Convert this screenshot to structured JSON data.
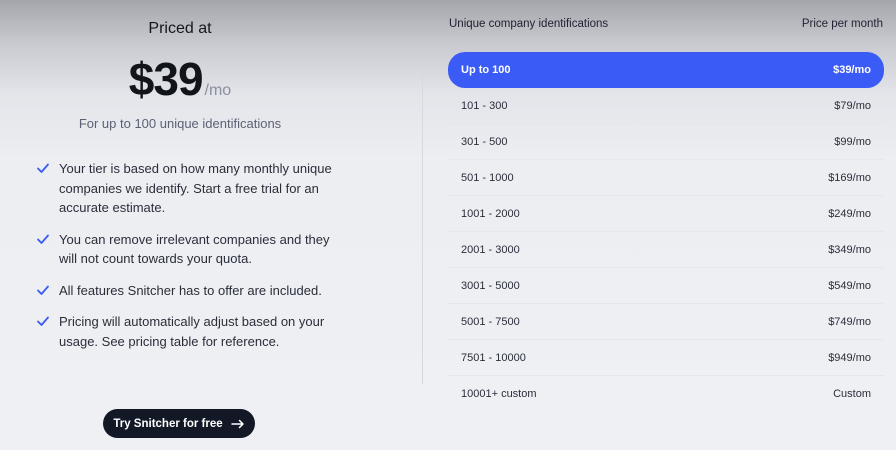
{
  "pricing": {
    "priced_at": "Priced at",
    "amount": "$39",
    "unit": "/mo",
    "for_line": "For up to 100 unique identifications"
  },
  "features": [
    "Your tier is based on how many monthly unique companies we identify. Start a free trial for an accurate estimate.",
    "You can remove irrelevant companies and they will not count towards your quota.",
    "All features Snitcher has to offer are included.",
    "Pricing will automatically adjust based on your usage. See pricing table for reference."
  ],
  "cta": {
    "label": "Try Snitcher for free",
    "icon": "arrow-right-icon"
  },
  "table": {
    "header_left": "Unique company identifications",
    "header_right": "Price per month",
    "rows": [
      {
        "range": "Up to 100",
        "price": "$39/mo",
        "selected": true
      },
      {
        "range": "101 - 300",
        "price": "$79/mo"
      },
      {
        "range": "301 - 500",
        "price": "$99/mo"
      },
      {
        "range": "501 - 1000",
        "price": "$169/mo"
      },
      {
        "range": "1001 - 2000",
        "price": "$249/mo"
      },
      {
        "range": "2001 - 3000",
        "price": "$349/mo"
      },
      {
        "range": "3001 - 5000",
        "price": "$549/mo"
      },
      {
        "range": "5001 - 7500",
        "price": "$749/mo"
      },
      {
        "range": "7501 - 10000",
        "price": "$949/mo"
      },
      {
        "range": "10001+ custom",
        "price": "Custom"
      }
    ]
  },
  "colors": {
    "accent": "#3b5bf6",
    "cta_bg": "#121826",
    "check": "#3b5bf6"
  }
}
